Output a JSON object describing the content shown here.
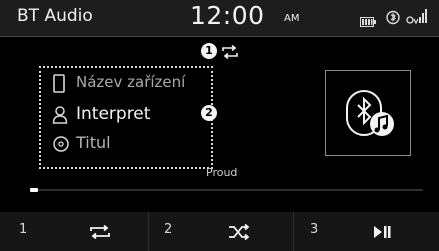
{
  "status_bar": {
    "title": "BT Audio",
    "time": "12:00",
    "ampm": "AM",
    "icons": [
      "battery-icon",
      "bluetooth-status-icon",
      "signal-strength-icon"
    ]
  },
  "markers": {
    "one": "1",
    "two": "2"
  },
  "now_playing": {
    "device_name": "Název zařízení",
    "artist": "Interpret",
    "title": "Titul",
    "album_art_icon": "bluetooth-music-icon",
    "source": "Proud",
    "progress": 0.02
  },
  "bottom_bar": {
    "presets": [
      "1",
      "2",
      "3"
    ],
    "buttons": [
      "repeat-icon",
      "shuffle-icon",
      "play-pause-icon"
    ]
  },
  "colors": {
    "background": "#000000",
    "bar": "#1d1d1d",
    "text": "#f2f2f2"
  }
}
